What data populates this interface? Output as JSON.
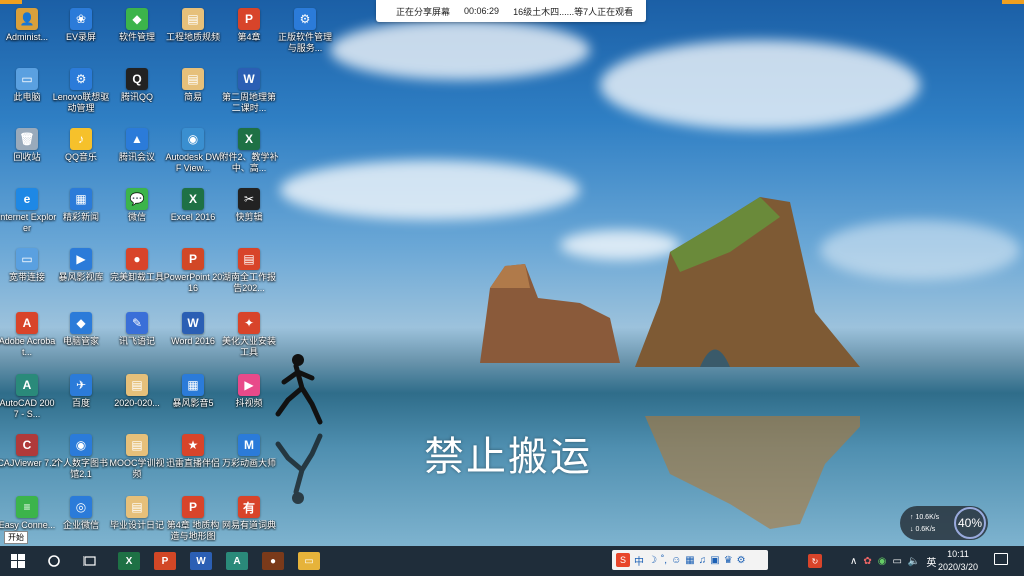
{
  "share_bar": {
    "status": "正在分享屏幕",
    "time": "00:06:29",
    "viewers": "16级土木四......等7人正在观看"
  },
  "watermark": "禁止搬运",
  "desktop_icons": [
    {
      "label": "Administ...",
      "color": "#d9a03b",
      "glyph": "👤"
    },
    {
      "label": "EV录屏",
      "color": "#2b7bd9",
      "glyph": "❀"
    },
    {
      "label": "软件管理",
      "color": "#3cb44b",
      "glyph": "◆"
    },
    {
      "label": "工程地质规频",
      "color": "#e6c07a",
      "glyph": "▤"
    },
    {
      "label": "第4章",
      "color": "#d8442a",
      "glyph": "P"
    },
    {
      "label": "正版软件管理与服务...",
      "color": "#2b7bd9",
      "glyph": "⚙"
    },
    {
      "label": "此电脑",
      "color": "#5aa0e0",
      "glyph": "▭"
    },
    {
      "label": "Lenovo联想驱动管理",
      "color": "#2b7bd9",
      "glyph": "⚙"
    },
    {
      "label": "腾讯QQ",
      "color": "#222",
      "glyph": "Q"
    },
    {
      "label": "简易",
      "color": "#e6c07a",
      "glyph": "▤"
    },
    {
      "label": "第二周地理第二课时...",
      "color": "#2b5fb4",
      "glyph": "W"
    },
    {
      "label": "回收站",
      "color": "#9ab",
      "glyph": "🗑"
    },
    {
      "label": "QQ音乐",
      "color": "#f6c12b",
      "glyph": "♪"
    },
    {
      "label": "腾讯会议",
      "color": "#2b7bd9",
      "glyph": "▲"
    },
    {
      "label": "Autodesk DWF View...",
      "color": "#3a8fd0",
      "glyph": "◉"
    },
    {
      "label": "附件2、教学补中、高...",
      "color": "#1e7145",
      "glyph": "X"
    },
    {
      "label": "Internet Explorer",
      "color": "#1e88e5",
      "glyph": "e"
    },
    {
      "label": "精彩新闻",
      "color": "#2b7bd9",
      "glyph": "▦"
    },
    {
      "label": "微信",
      "color": "#3cb44b",
      "glyph": "💬"
    },
    {
      "label": "Excel 2016",
      "color": "#1e7145",
      "glyph": "X"
    },
    {
      "label": "快剪辑",
      "color": "#222",
      "glyph": "✂"
    },
    {
      "label": "宽带连接",
      "color": "#5aa0e0",
      "glyph": "▭"
    },
    {
      "label": "暴风影视库",
      "color": "#2b7bd9",
      "glyph": "▶"
    },
    {
      "label": "完美卸载工具",
      "color": "#d8442a",
      "glyph": "●"
    },
    {
      "label": "PowerPoint 2016",
      "color": "#d24726",
      "glyph": "P"
    },
    {
      "label": "湖南全工作报告202...",
      "color": "#d8442a",
      "glyph": "▤"
    },
    {
      "label": "Adobe Acrobat...",
      "color": "#d8442a",
      "glyph": "A"
    },
    {
      "label": "电脑管家",
      "color": "#2b7bd9",
      "glyph": "◆"
    },
    {
      "label": "讯飞语记",
      "color": "#3a6fd8",
      "glyph": "✎"
    },
    {
      "label": "Word 2016",
      "color": "#2b5fb4",
      "glyph": "W"
    },
    {
      "label": "美化大业安装工具",
      "color": "#d8442a",
      "glyph": "✦"
    },
    {
      "label": "AutoCAD 2007 - S...",
      "color": "#2a8a7a",
      "glyph": "A"
    },
    {
      "label": "百度",
      "color": "#2b7bd9",
      "glyph": "✈"
    },
    {
      "label": "2020-020...",
      "color": "#e6c07a",
      "glyph": "▤"
    },
    {
      "label": "暴风影音5",
      "color": "#2b7bd9",
      "glyph": "▦"
    },
    {
      "label": "抖视频",
      "color": "#e84a8a",
      "glyph": "▶"
    },
    {
      "label": "CAJViewer 7.2",
      "color": "#b03a3a",
      "glyph": "C"
    },
    {
      "label": "个人数字图书馆2.1",
      "color": "#2b7bd9",
      "glyph": "◉"
    },
    {
      "label": "MOOC学训视频",
      "color": "#e6c07a",
      "glyph": "▤"
    },
    {
      "label": "迅雷直播伴侣",
      "color": "#d8442a",
      "glyph": "★"
    },
    {
      "label": "万彩动画大师",
      "color": "#2b7bd9",
      "glyph": "M"
    },
    {
      "label": "Easy Conne...",
      "color": "#3cb44b",
      "glyph": "≡"
    },
    {
      "label": "企业微信",
      "color": "#2b7bd9",
      "glyph": "◎"
    },
    {
      "label": "毕业设计日记",
      "color": "#e6c07a",
      "glyph": "▤"
    },
    {
      "label": "第4章 地质构造与地形图",
      "color": "#d8442a",
      "glyph": "P"
    },
    {
      "label": "网易有道词典",
      "color": "#d8442a",
      "glyph": "有"
    }
  ],
  "net_widget": {
    "up": "↑ 10.6K/s",
    "down": "↓ 0.6K/s",
    "percent": "40%"
  },
  "taskbar": {
    "start_tooltip": "开始",
    "apps": [
      {
        "name": "excel",
        "color": "#1e7145",
        "glyph": "X"
      },
      {
        "name": "powerpoint",
        "color": "#d24726",
        "glyph": "P"
      },
      {
        "name": "word",
        "color": "#2b5fb4",
        "glyph": "W"
      },
      {
        "name": "autocad",
        "color": "#2a8a7a",
        "glyph": "A"
      },
      {
        "name": "game",
        "color": "#7a3a1a",
        "glyph": "●"
      },
      {
        "name": "explorer",
        "color": "#e6b33a",
        "glyph": "▭"
      }
    ],
    "ime_lang": "中",
    "clock_time": "10:11",
    "clock_date": "2020/3/20"
  }
}
